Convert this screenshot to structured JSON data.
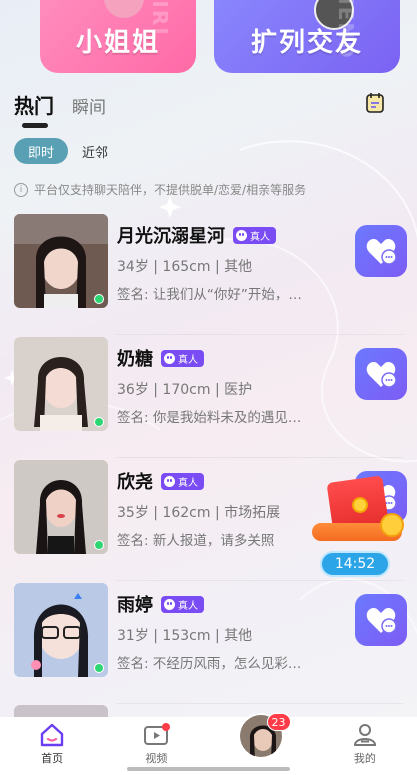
{
  "banners": [
    {
      "label": "小姐姐",
      "ghost": "GIRL"
    },
    {
      "label": "扩列交友",
      "ghost": "FRIEND"
    }
  ],
  "tabs": {
    "main": "热门",
    "sub": "瞬间"
  },
  "chips": {
    "active": "即时",
    "other": "近邻"
  },
  "notice": "平台仅支持聊天陪伴，不提供脱单/恋爱/相亲等服务",
  "badge_label": "真人",
  "users": [
    {
      "name": "月光沉溺星河",
      "meta": "34岁 | 165cm | 其他",
      "signature": "签名: 让我们从“你好”开始，…",
      "online": true
    },
    {
      "name": "奶糖",
      "meta": "36岁 | 170cm | 医护",
      "signature": "签名: 你是我始料未及的遇见…",
      "online": true
    },
    {
      "name": "欣尧",
      "meta": "35岁 | 162cm | 市场拓展",
      "signature": "签名: 新人报道，请多关照",
      "online": true
    },
    {
      "name": "雨婷",
      "meta": "31岁 | 153cm | 其他",
      "signature": "签名: 不经历风雨，怎么见彩…",
      "online": true
    }
  ],
  "timer": "14:52",
  "nav": {
    "home": "首页",
    "video": "视频",
    "messages_count": "23",
    "mine": "我的"
  },
  "colors": {
    "accent_purple": "#7a4cf4",
    "online_green": "#2ed573",
    "chip_teal": "#5aa0b4",
    "badge_red": "#ff3b47"
  }
}
